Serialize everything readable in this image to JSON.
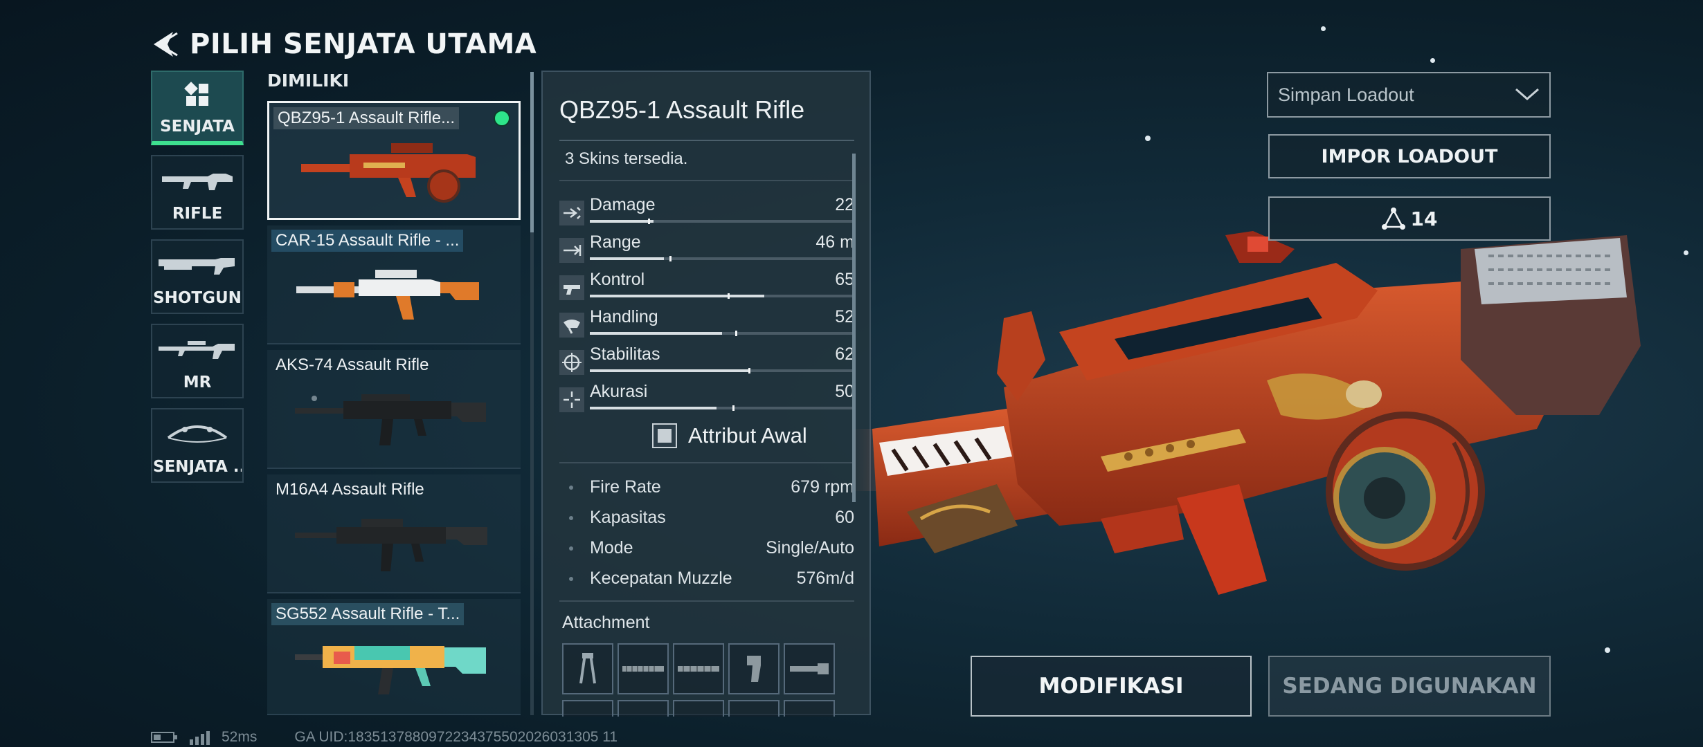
{
  "header": {
    "title": "PILIH SENJATA UTAMA"
  },
  "categories": [
    {
      "label": "SENJATA",
      "icon": "grid-icon",
      "active": true
    },
    {
      "label": "RIFLE",
      "icon": "rifle-icon",
      "active": false
    },
    {
      "label": "SHOTGUN",
      "icon": "shotgun-icon",
      "active": false
    },
    {
      "label": "MR",
      "icon": "marksman-rifle-icon",
      "active": false
    },
    {
      "label": "SENJATA ...",
      "icon": "bow-icon",
      "active": false
    }
  ],
  "owned": {
    "label": "DIMILIKI",
    "weapons": [
      {
        "name": "QBZ95-1 Assault Rifle...",
        "selected": true,
        "equipped": true
      },
      {
        "name": "CAR-15 Assault Rifle - ...",
        "selected": false
      },
      {
        "name": "AKS-74 Assault Rifle",
        "selected": false
      },
      {
        "name": "M16A4 Assault Rifle",
        "selected": false
      },
      {
        "name": "SG552 Assault Rifle - T...",
        "selected": false
      }
    ]
  },
  "details": {
    "title": "QBZ95-1 Assault Rifle",
    "skins_text": "3 Skins tersedia.",
    "stats": [
      {
        "label": "Damage",
        "value": "22",
        "icon": "damage-icon",
        "fill": 0.24,
        "marker": 0.22
      },
      {
        "label": "Range",
        "value": "46 m",
        "icon": "range-icon",
        "fill": 0.28,
        "marker": 0.3
      },
      {
        "label": "Kontrol",
        "value": "65",
        "icon": "control-icon",
        "fill": 0.66,
        "marker": 0.52
      },
      {
        "label": "Handling",
        "value": "52",
        "icon": "handling-icon",
        "fill": 0.5,
        "marker": 0.55
      },
      {
        "label": "Stabilitas",
        "value": "62",
        "icon": "stability-icon",
        "fill": 0.6,
        "marker": 0.6
      },
      {
        "label": "Akurasi",
        "value": "50",
        "icon": "accuracy-icon",
        "fill": 0.48,
        "marker": 0.54
      }
    ],
    "attribut_awal_label": "Attribut Awal",
    "specs": [
      {
        "label": "Fire Rate",
        "value": "679 rpm"
      },
      {
        "label": "Kapasitas",
        "value": "60"
      },
      {
        "label": "Mode",
        "value": "Single/Auto"
      },
      {
        "label": "Kecepatan Muzzle",
        "value": "576m/d"
      }
    ],
    "attachment_label": "Attachment"
  },
  "right": {
    "loadout_select_placeholder": "Simpan Loadout",
    "import_label": "IMPOR LOADOUT",
    "points": "14"
  },
  "actions": {
    "modify_label": "MODIFIKASI",
    "in_use_label": "SEDANG DIGUNAKAN"
  },
  "status": {
    "ping": "52ms",
    "uid": "GA UID:1835137880972234375502026031305 11"
  },
  "colors": {
    "accent_green": "#3ee08f",
    "background": "#0e2431",
    "weapon_skin": "#c3401f"
  }
}
